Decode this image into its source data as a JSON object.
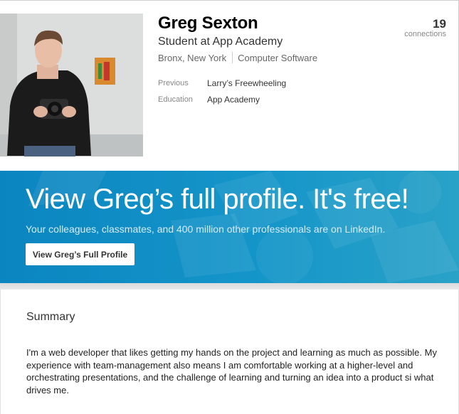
{
  "profile": {
    "name": "Greg Sexton",
    "headline": "Student at App Academy",
    "location": "Bronx, New York",
    "industry": "Computer Software",
    "photo_icon": "profile-photo",
    "details": [
      {
        "label": "Previous",
        "value": "Larry’s Freewheeling"
      },
      {
        "label": "Education",
        "value": "App Academy"
      }
    ],
    "connections": {
      "count": "19",
      "label": "connections"
    }
  },
  "banner": {
    "title": "View Greg’s full profile. It's free!",
    "subtitle": "Your colleagues, classmates, and 400 million other professionals are on LinkedIn.",
    "button_label": "View Greg’s Full Profile",
    "color": "#0b85c0"
  },
  "summary": {
    "title": "Summary",
    "body": "I'm a web developer that likes getting my hands on the project and learning as much as possible. My experience with team-management also means I am comfortable working at a higher-level and orchestrating presentations, and the challenge of learning and turning an idea into a product si what drives me."
  }
}
